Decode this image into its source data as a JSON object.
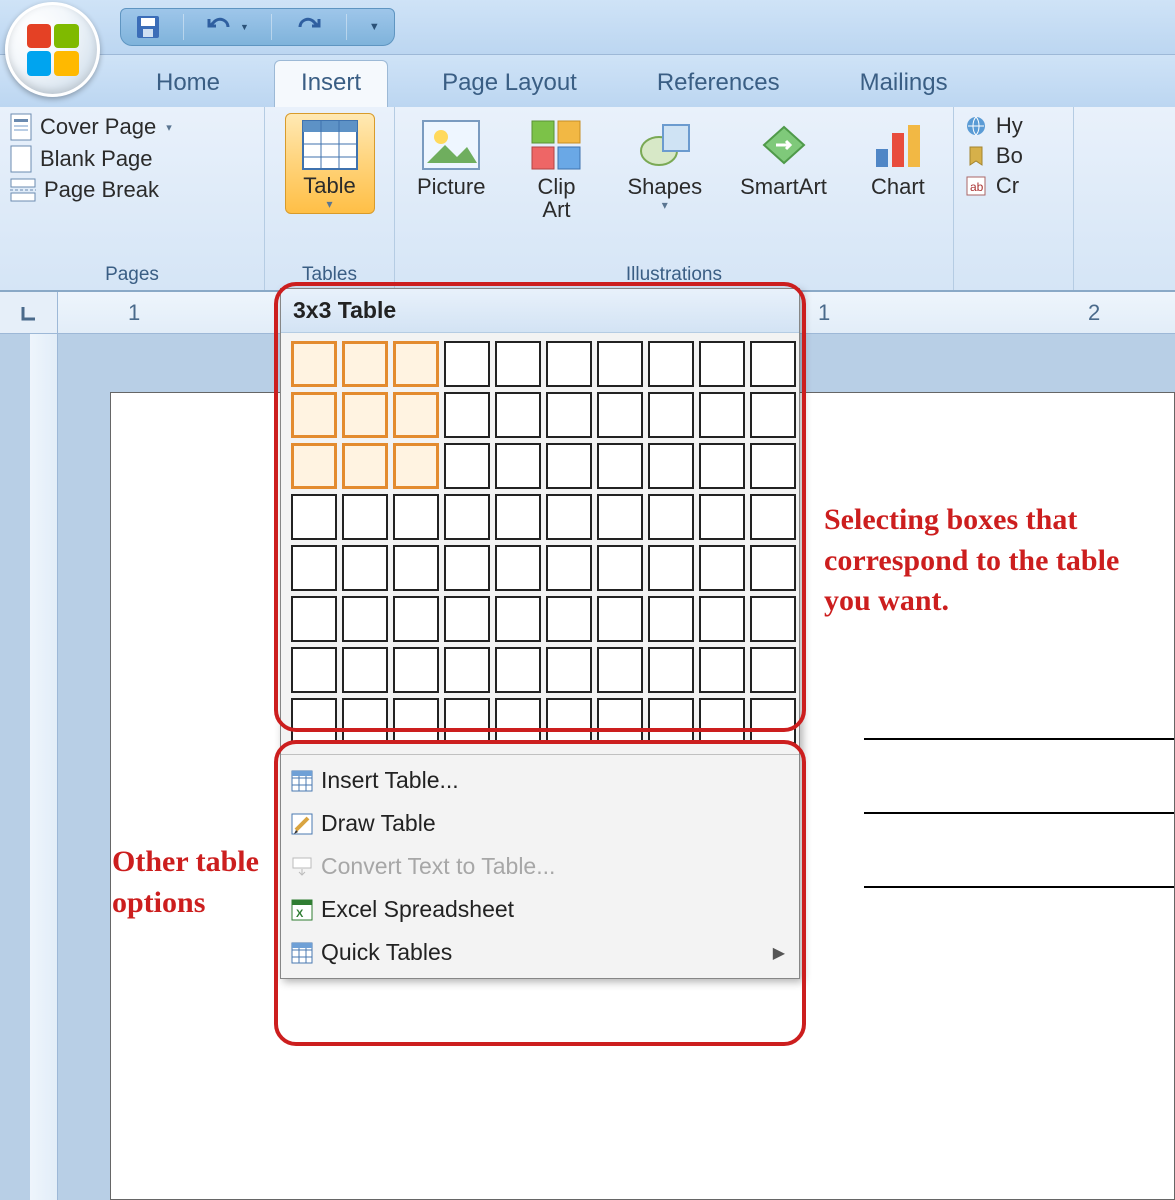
{
  "qat": {
    "save": "save",
    "undo": "undo",
    "redo": "redo"
  },
  "tabs": [
    "Home",
    "Insert",
    "Page Layout",
    "References",
    "Mailings"
  ],
  "active_tab": "Insert",
  "ribbon": {
    "pages": {
      "label": "Pages",
      "items": [
        "Cover Page",
        "Blank Page",
        "Page Break"
      ]
    },
    "tables": {
      "label": "Tables",
      "button": "Table"
    },
    "illustrations": {
      "label": "Illustrations",
      "buttons": [
        "Picture",
        "Clip\nArt",
        "Shapes",
        "SmartArt",
        "Chart"
      ]
    },
    "links": {
      "items": [
        "Hy",
        "Bo",
        "Cr"
      ]
    }
  },
  "ruler": {
    "marks": [
      "1",
      "1",
      "2"
    ]
  },
  "flyout": {
    "title": "3x3 Table",
    "grid": {
      "rows": 8,
      "cols": 10,
      "sel_rows": 3,
      "sel_cols": 3
    },
    "menu": [
      {
        "label": "Insert Table...",
        "name": "insert-table",
        "icon": "grid"
      },
      {
        "label": "Draw Table",
        "name": "draw-table",
        "icon": "pencil"
      },
      {
        "label": "Convert Text to Table...",
        "name": "convert-text",
        "icon": "convert",
        "disabled": true
      },
      {
        "label": "Excel Spreadsheet",
        "name": "excel-spreadsheet",
        "icon": "excel"
      },
      {
        "label": "Quick Tables",
        "name": "quick-tables",
        "icon": "grid",
        "submenu": true
      }
    ]
  },
  "annotations": {
    "grid_note": "Selecting boxes that correspond to the table you want.",
    "menu_note": "Other table options"
  }
}
